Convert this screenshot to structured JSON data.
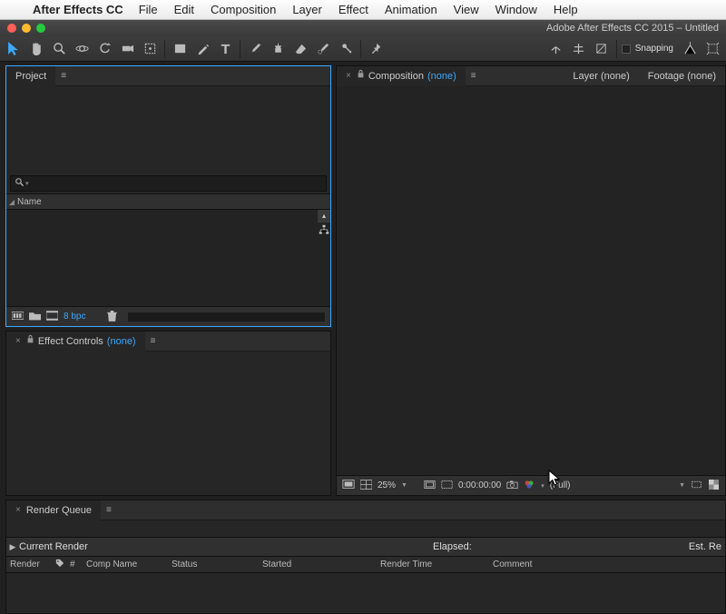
{
  "menubar": {
    "app": "After Effects CC",
    "items": [
      "File",
      "Edit",
      "Composition",
      "Layer",
      "Effect",
      "Animation",
      "View",
      "Window",
      "Help"
    ]
  },
  "window_title": "Adobe After Effects CC 2015 – Untitled",
  "toolbar": {
    "snapping_label": "Snapping"
  },
  "project": {
    "tab": "Project",
    "col_name": "Name",
    "bpc": "8 bpc"
  },
  "effect_controls": {
    "tab": "Effect Controls",
    "none": "(none)"
  },
  "composition": {
    "tab": "Composition",
    "none": "(none)",
    "layer_tab": "Layer (none)",
    "footage_tab": "Footage (none)",
    "zoom": "25%",
    "timecode": "0:00:00:00",
    "res": "(Full)"
  },
  "render_queue": {
    "tab": "Render Queue",
    "current": "Current Render",
    "elapsed": "Elapsed:",
    "est": "Est. Re",
    "cols": {
      "render": "Render",
      "num": "#",
      "comp": "Comp Name",
      "status": "Status",
      "started": "Started",
      "render_time": "Render Time",
      "comment": "Comment"
    }
  }
}
